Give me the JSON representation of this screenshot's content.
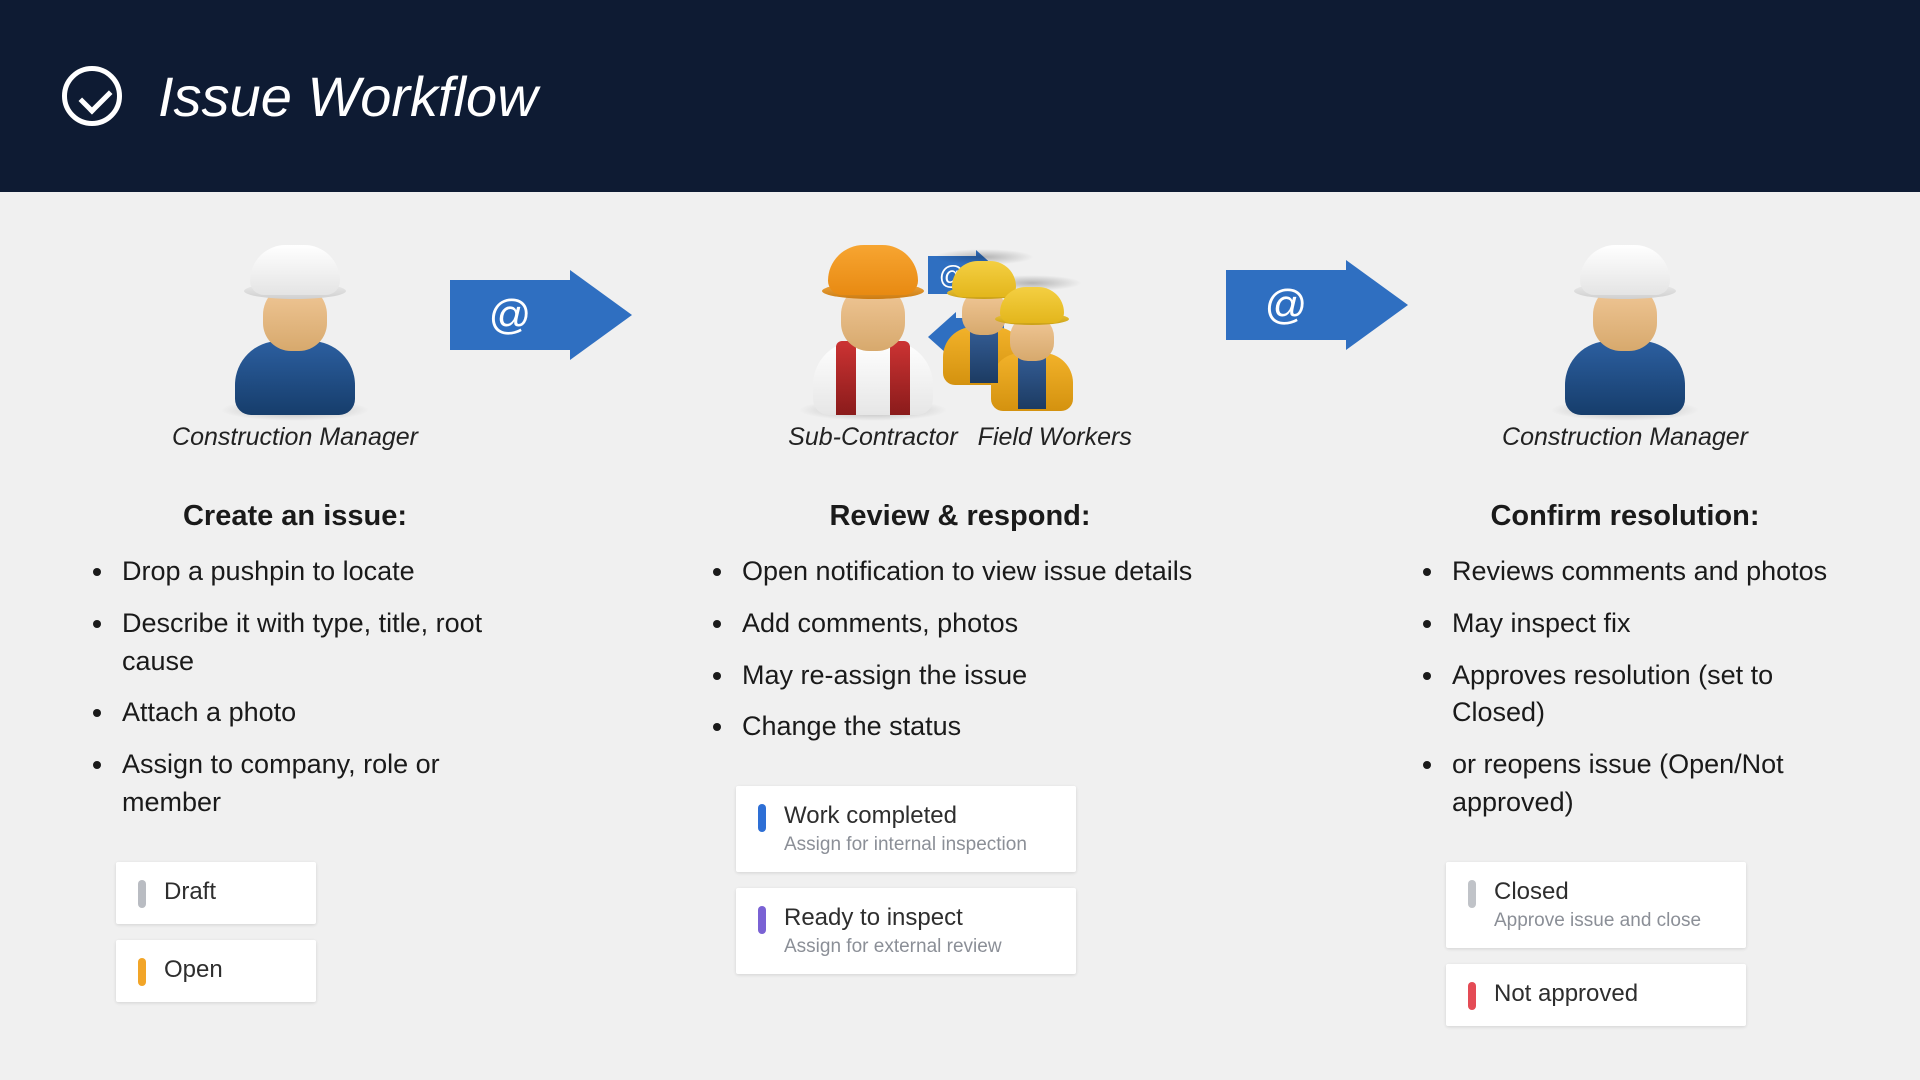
{
  "header": {
    "title": "Issue Workflow"
  },
  "actors": {
    "manager1": "Construction Manager",
    "subcontractor": "Sub-Contractor",
    "fieldworkers": "Field Workers",
    "manager2": "Construction Manager"
  },
  "arrow_symbol": "@",
  "columns": {
    "create": {
      "title": "Create an issue:",
      "bullets": [
        "Drop a pushpin to locate",
        "Describe it with type, title, root cause",
        "Attach a photo",
        "Assign to company, role or member"
      ],
      "statuses": [
        {
          "label": "Draft",
          "sub": "",
          "color": "gray"
        },
        {
          "label": "Open",
          "sub": "",
          "color": "orange"
        }
      ]
    },
    "review": {
      "title": "Review & respond:",
      "bullets": [
        "Open notification to view issue details",
        "Add comments, photos",
        "May re-assign the issue",
        "Change the status"
      ],
      "statuses": [
        {
          "label": "Work completed",
          "sub": "Assign for internal inspection",
          "color": "blue"
        },
        {
          "label": "Ready to inspect",
          "sub": "Assign for external review",
          "color": "purple"
        }
      ]
    },
    "confirm": {
      "title": "Confirm resolution:",
      "bullets": [
        "Reviews comments and photos",
        "May inspect fix",
        "Approves resolution (set to Closed)",
        "or reopens issue (Open/Not approved)"
      ],
      "statuses": [
        {
          "label": "Closed",
          "sub": "Approve issue and close",
          "color": "lgray"
        },
        {
          "label": "Not approved",
          "sub": "",
          "color": "red"
        }
      ]
    }
  }
}
